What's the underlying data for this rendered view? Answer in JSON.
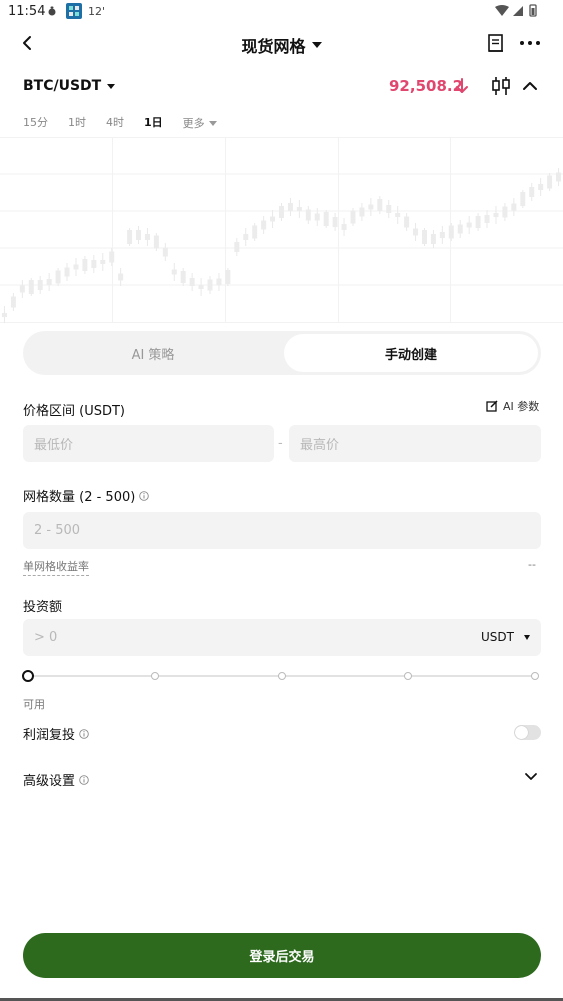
{
  "status_bar": {
    "time": "11:54",
    "temp": "12'"
  },
  "header": {
    "title": "现货网格"
  },
  "pair": {
    "symbol": "BTC/USDT",
    "price": "92,508.2",
    "price_color": "#e0466e"
  },
  "intervals": {
    "items": [
      "15分",
      "1时",
      "4时",
      "1日"
    ],
    "active": "1日",
    "more_label": "更多"
  },
  "tabs": {
    "ai_label": "AI 策略",
    "manual_label": "手动创建",
    "active": "手动创建"
  },
  "price_range": {
    "label": "价格区间 (USDT)",
    "ai_param_label": "AI 参数",
    "min_placeholder": "最低价",
    "separator": "-",
    "max_placeholder": "最高价"
  },
  "grid_count": {
    "label": "网格数量 (2 - 500)",
    "placeholder": "2 - 500",
    "yield_label": "单网格收益率",
    "yield_value": "--"
  },
  "investment": {
    "label": "投资额",
    "placeholder": "> 0",
    "unit": "USDT",
    "available_label": "可用",
    "slider_value_percent": 0
  },
  "reinvest": {
    "label": "利润复投",
    "enabled": false
  },
  "advanced": {
    "label": "高级设置"
  },
  "login_button": {
    "label": "登录后交易",
    "color": "#2d6a1e"
  }
}
